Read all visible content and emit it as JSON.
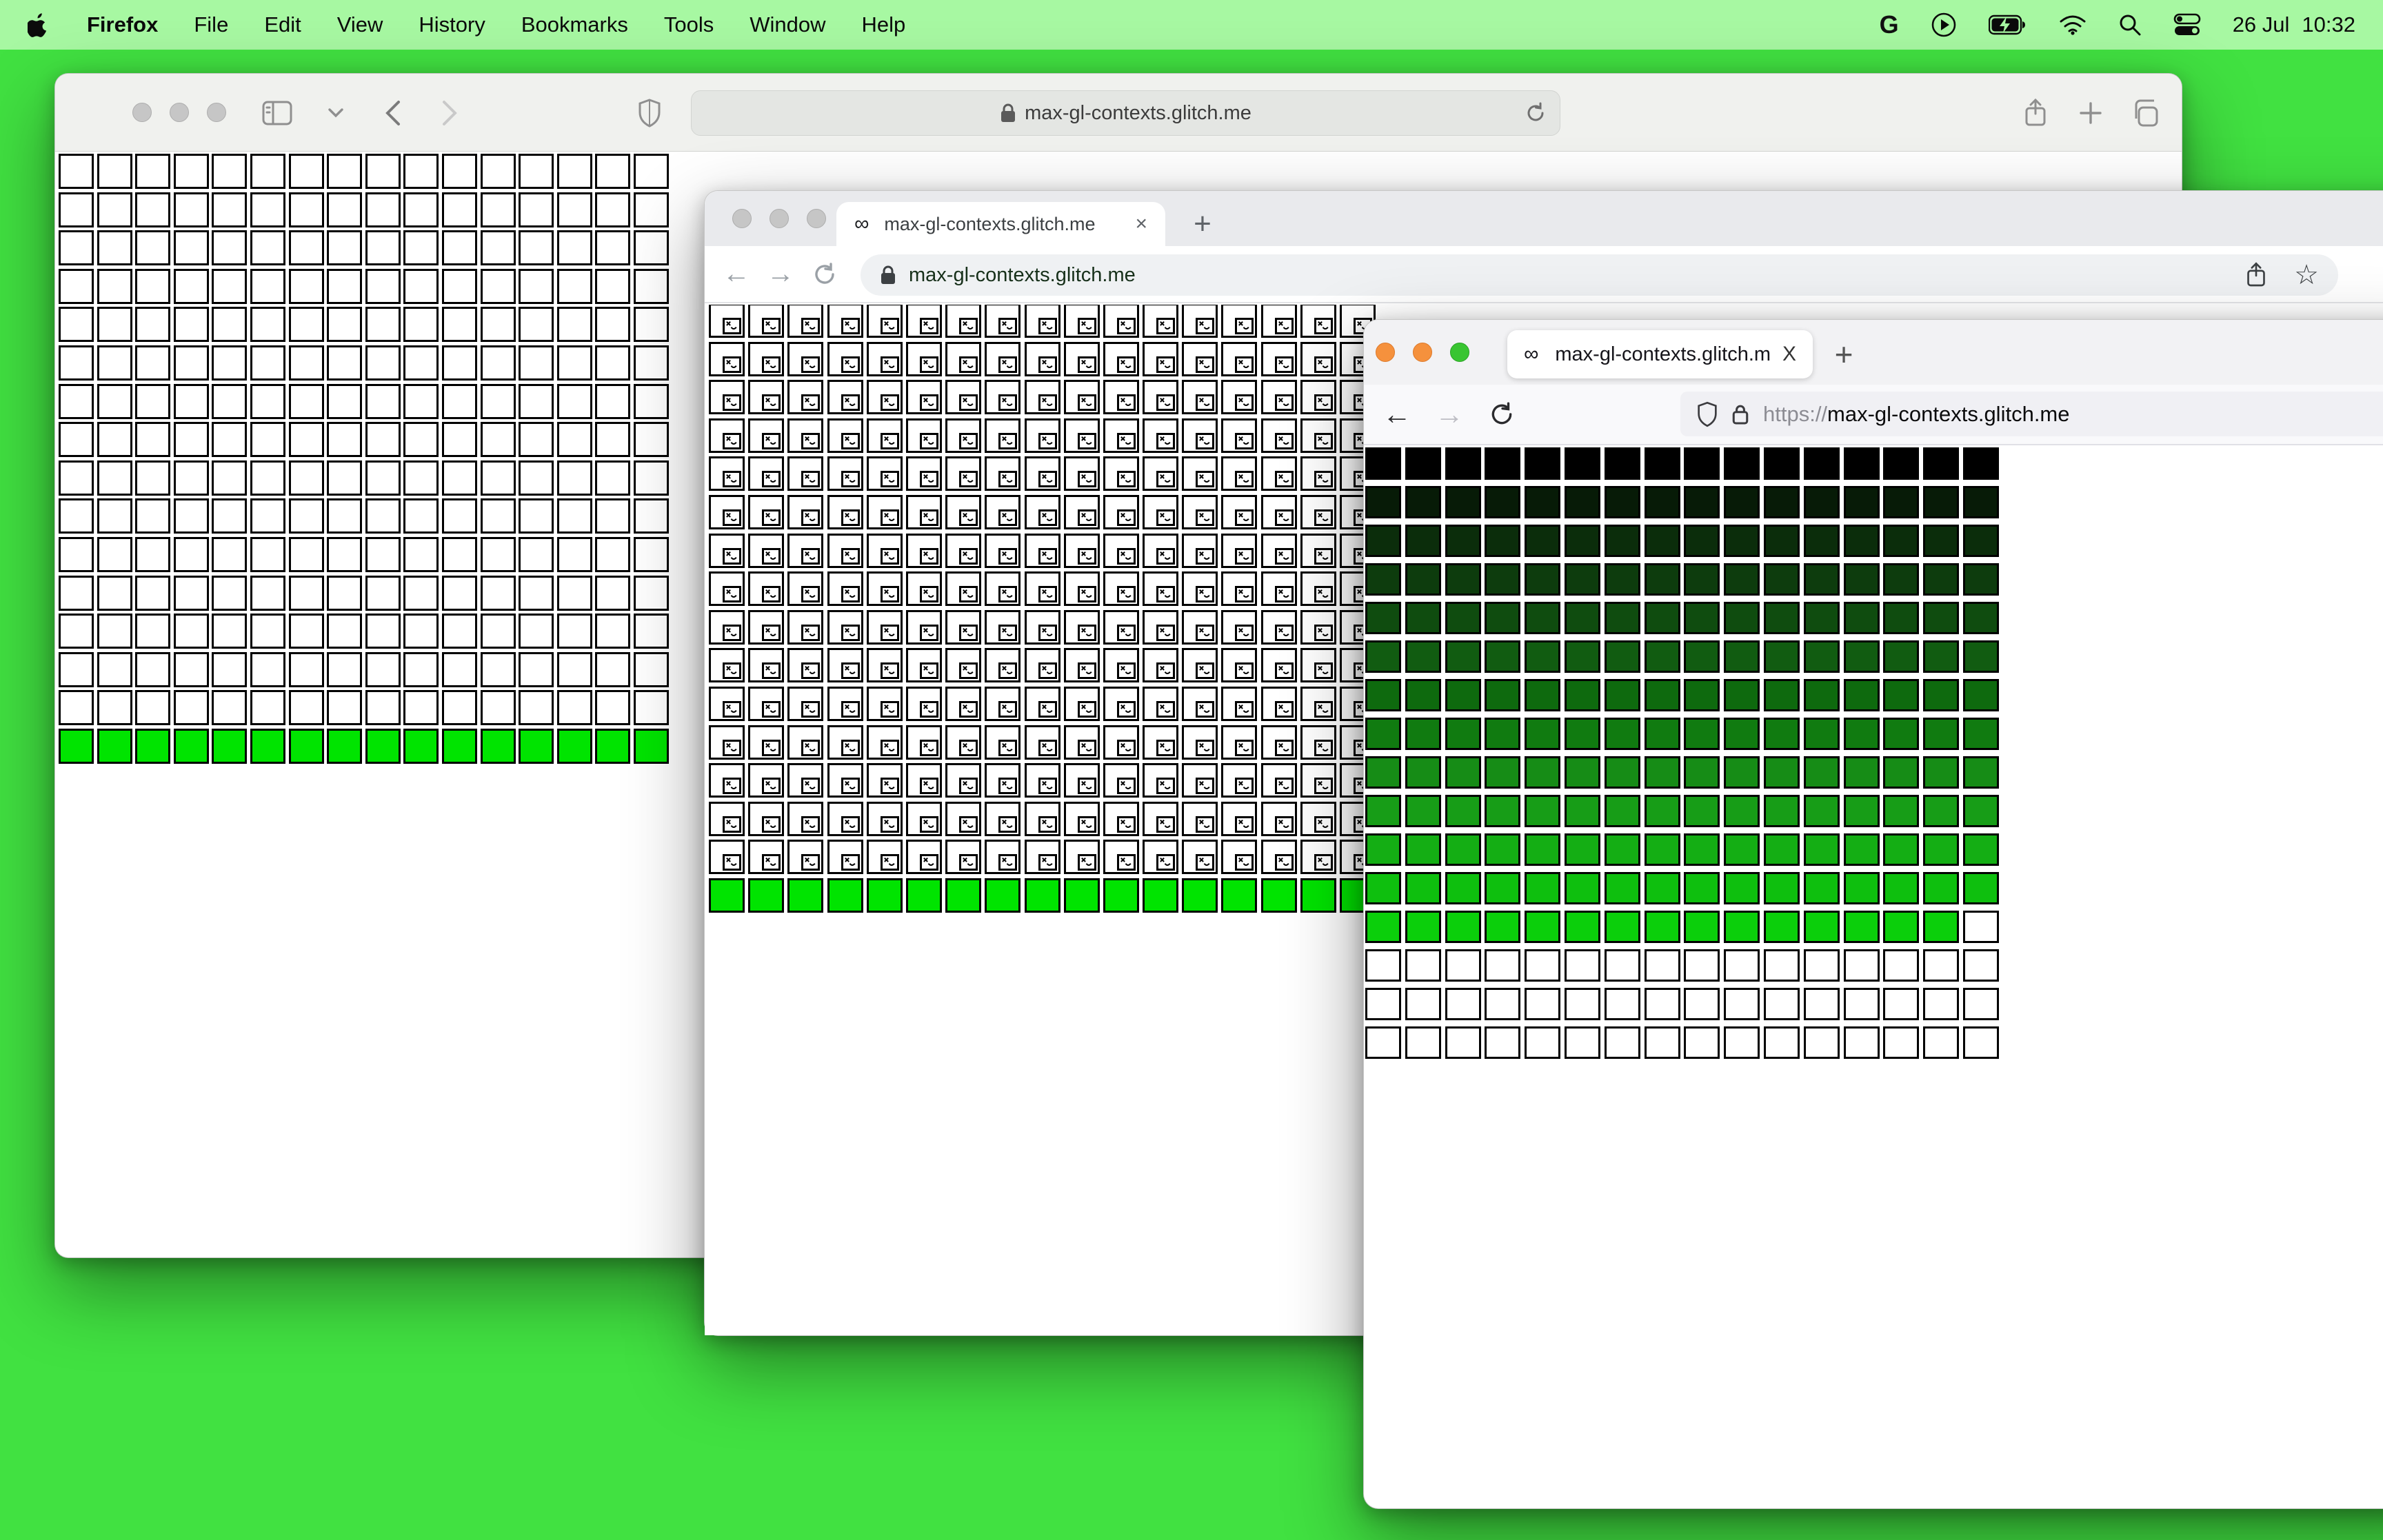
{
  "desktop": {
    "background": "#41E141",
    "menubar_background": "#A7F8A2"
  },
  "menu_bar": {
    "app_name": "Firefox",
    "menus": [
      "File",
      "Edit",
      "View",
      "History",
      "Bookmarks",
      "Tools",
      "Window",
      "Help"
    ],
    "status_icons": [
      "google-icon",
      "play-icon",
      "battery-charging-icon",
      "wifi-icon",
      "spotlight-search-icon",
      "control-center-icon"
    ],
    "google_glyph": "G",
    "date": "26 Jul",
    "time": "10:32"
  },
  "safari_window": {
    "url": "max-gl-contexts.glitch.me",
    "grid": {
      "columns": 16,
      "rows": 16,
      "empty_cell_color": "#FFFFFF",
      "filled_row_color": "#00E400",
      "filled_row_index": 16
    }
  },
  "chrome_window": {
    "tab": {
      "favicon": "∞",
      "title": "max-gl-contexts.glitch.me",
      "close_label": "×",
      "new_tab_label": "+"
    },
    "url": "max-gl-contexts.glitch.me",
    "grid": {
      "columns": 17,
      "rows": 16,
      "broken_rows": 15,
      "broken_cell_color": "#FFFFFF",
      "filled_row_color": "#00E400"
    }
  },
  "firefox_window": {
    "tab": {
      "favicon": "∞",
      "title": "max-gl-contexts.glitch.me/",
      "close_label": "X",
      "new_tab_label": "+"
    },
    "url_scheme": "https://",
    "url_host": "max-gl-contexts.glitch.me",
    "grid": {
      "columns": 16,
      "rows": [
        {
          "color": "#000000",
          "filled": 16
        },
        {
          "color": "#071B07",
          "filled": 16
        },
        {
          "color": "#0B2D0B",
          "filled": 16
        },
        {
          "color": "#0D3C0D",
          "filled": 16
        },
        {
          "color": "#0F4C0F",
          "filled": 16
        },
        {
          "color": "#115C11",
          "filled": 16
        },
        {
          "color": "#0E6A0E",
          "filled": 16
        },
        {
          "color": "#107B10",
          "filled": 16
        },
        {
          "color": "#168C16",
          "filled": 16
        },
        {
          "color": "#179D17",
          "filled": 16
        },
        {
          "color": "#14AE14",
          "filled": 16
        },
        {
          "color": "#0EBF0E",
          "filled": 16
        },
        {
          "color": "#0BCF0B",
          "filled": 15
        },
        {
          "color": "#FFFFFF",
          "filled": 16
        },
        {
          "color": "#FFFFFF",
          "filled": 16
        },
        {
          "color": "#FFFFFF",
          "filled": 16
        }
      ],
      "empty_cell_color": "#FFFFFF"
    }
  }
}
